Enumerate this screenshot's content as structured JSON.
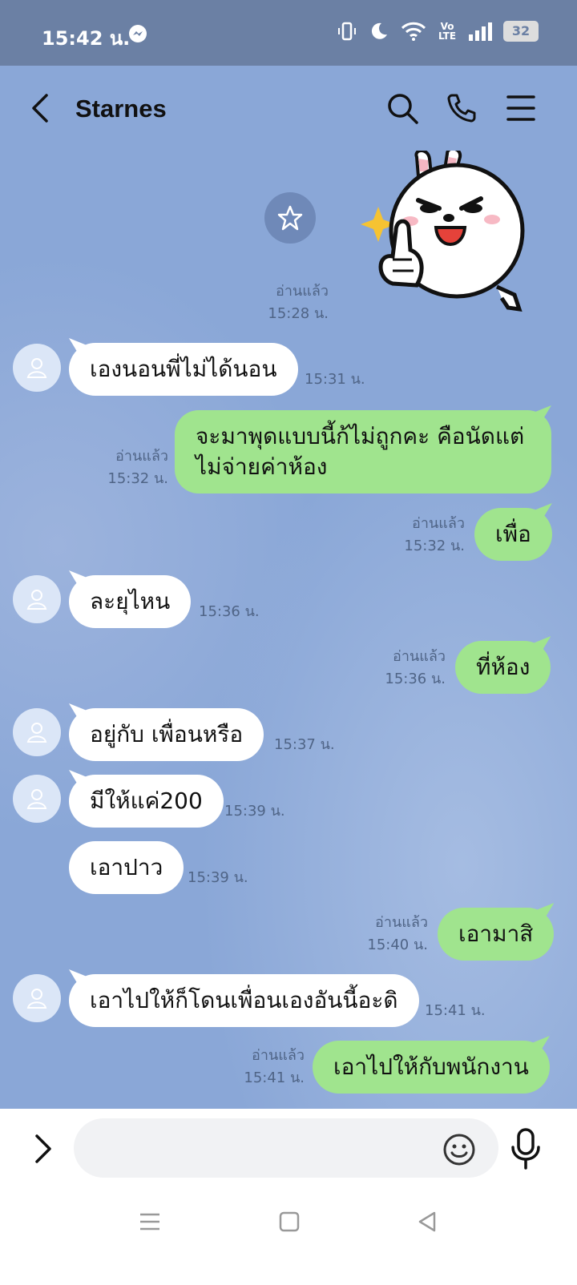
{
  "status": {
    "time": "15:42 น.",
    "network": "Vo LTE",
    "battery": "32"
  },
  "header": {
    "title": "Starnes"
  },
  "messages": [
    {
      "dir": "out",
      "read": "อ่านแล้ว",
      "time": "15:28 น.",
      "sticker": "thumbs-up-bunny"
    },
    {
      "dir": "in",
      "text": "เองนอนพี่ไม่ได้นอน",
      "time": "15:31 น."
    },
    {
      "dir": "out",
      "read": "อ่านแล้ว",
      "text": "จะมาพุดแบบนี้ก้ไม่ถูกคะ คือนัดแต่ไม่จ่ายค่าห้อง",
      "time": "15:32 น."
    },
    {
      "dir": "out",
      "read": "อ่านแล้ว",
      "text": "เพื่อ",
      "time": "15:32 น."
    },
    {
      "dir": "in",
      "text": "ละยุไหน",
      "time": "15:36 น."
    },
    {
      "dir": "out",
      "read": "อ่านแล้ว",
      "text": "ที่ห้อง",
      "time": "15:36 น."
    },
    {
      "dir": "in",
      "text": "อยู่กับ เพื่อนหรือ",
      "time": "15:37 น."
    },
    {
      "dir": "in",
      "text": "มีให้แค่200",
      "time": "15:39 น."
    },
    {
      "dir": "in",
      "text": "เอาปาว",
      "time": "15:39 น."
    },
    {
      "dir": "out",
      "read": "อ่านแล้ว",
      "text": "เอามาสิ",
      "time": "15:40 น."
    },
    {
      "dir": "in",
      "text": "เอาไปให้ก็โดนเพื่อนเองอันนี้อะดิ",
      "time": "15:41 น."
    },
    {
      "dir": "out",
      "read": "อ่านแล้ว",
      "text": "เอาไปให้กับพนักงาน",
      "time": "15:41 น."
    }
  ],
  "input": {
    "placeholder": ""
  },
  "icons": {
    "back": "back-icon",
    "search": "search-icon",
    "call": "phone-icon",
    "menu": "menu-icon",
    "expand": "chevron-right-icon",
    "emoji": "emoji-icon",
    "mic": "microphone-icon",
    "favorite": "star-icon"
  },
  "colors": {
    "chat_bg": "#8aa7d7",
    "status_bar": "#6b80a4",
    "outgoing_bubble": "#a0e48e",
    "incoming_bubble": "#ffffff"
  }
}
